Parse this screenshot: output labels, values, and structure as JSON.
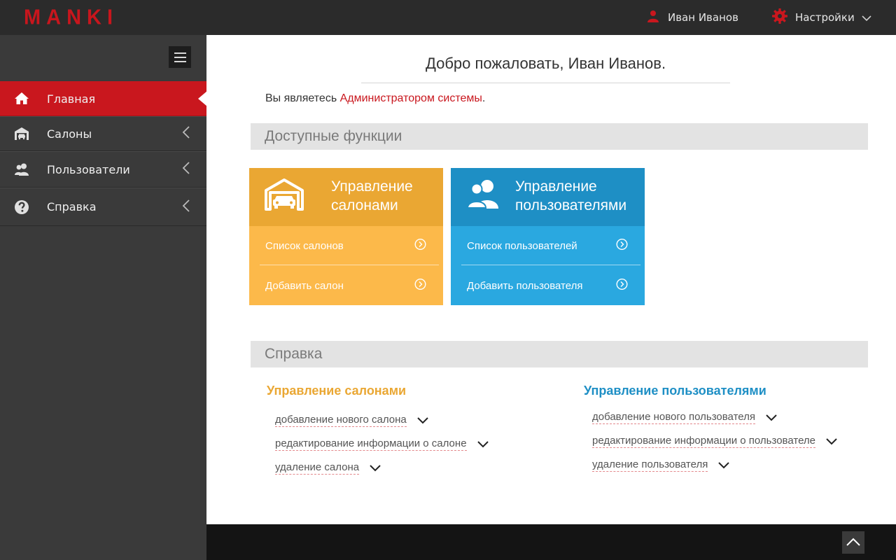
{
  "app": {
    "logo": "MANKI"
  },
  "header": {
    "user_name": "Иван Иванов",
    "settings_label": "Настройки"
  },
  "sidebar": {
    "items": [
      {
        "label": "Главная",
        "icon": "home-icon",
        "active": true
      },
      {
        "label": "Салоны",
        "icon": "garage-icon",
        "active": false
      },
      {
        "label": "Пользователи",
        "icon": "users-icon",
        "active": false
      },
      {
        "label": "Справка",
        "icon": "help-icon",
        "active": false
      }
    ]
  },
  "main": {
    "welcome": "Добро пожаловать, Иван Иванов.",
    "role_prefix": "Вы являетесь ",
    "role_link": "Администратором системы",
    "role_suffix": ".",
    "functions_title": "Доступные функции",
    "cards": [
      {
        "title_line1": "Управление",
        "title_line2": "салонами",
        "icon": "garage-car-icon",
        "color": "#eaa733",
        "links": [
          "Список салонов",
          "Добавить салон"
        ]
      },
      {
        "title_line1": "Управление",
        "title_line2": "пользователями",
        "icon": "users-icon",
        "color": "#1e8fc5",
        "links": [
          "Список пользователей",
          "Добавить пользователя"
        ]
      }
    ],
    "help_title": "Справка",
    "help": [
      {
        "title": "Управление салонами",
        "items": [
          "добавление нового салона",
          "редактирование информации о салоне",
          "удаление салона"
        ]
      },
      {
        "title": "Управление пользователями",
        "items": [
          "добавление нового пользователя",
          "редактирование информации о пользователе",
          "удаление пользователя"
        ]
      }
    ]
  },
  "colors": {
    "accent": "#c9171e",
    "orange": "#eaa733",
    "blue": "#1e8fc5"
  }
}
